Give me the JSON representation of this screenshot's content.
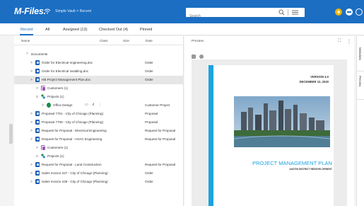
{
  "header": {
    "logo": "M-Files.",
    "vault_path": "Simple Vault > Recent",
    "search_placeholder": "Search"
  },
  "tabs": [
    {
      "label": "Recent",
      "active": true
    },
    {
      "label": "All"
    },
    {
      "label": "Assigned (13)"
    },
    {
      "label": "Checked Out (4)"
    },
    {
      "label": "Pinned"
    }
  ],
  "columns": {
    "name": "Name",
    "class": "Class",
    "size": "Size",
    "date": "Date"
  },
  "rows": [
    {
      "name": "Documents",
      "class": "",
      "arrow": "^",
      "icon": "none"
    },
    {
      "name": "Order for Electrical engineering.doc",
      "class": "Order",
      "arrow": ">",
      "icon": "doc"
    },
    {
      "name": "Order for Electrical installing.doc",
      "class": "Order",
      "arrow": ">",
      "icon": "doc"
    },
    {
      "name": "HB Project Management Plan.doc",
      "class": "Order",
      "arrow": ">",
      "icon": "doc",
      "selected": true
    },
    {
      "name": "Customers (1)",
      "class": "",
      "arrow": ">",
      "icon": "grid"
    },
    {
      "name": "Projects (1)",
      "class": "",
      "arrow": "v",
      "icon": "proj"
    },
    {
      "name": "Office Design",
      "class": "Customer Project",
      "arrow": ">",
      "icon": "office"
    },
    {
      "name": "Proposal 7701 - City of Chicago (Planning)",
      "class": "Proposal",
      "arrow": ">",
      "icon": "doc"
    },
    {
      "name": "Proposal 7708 - City of Chicago (Planning)",
      "class": "Proposal",
      "arrow": ">",
      "icon": "doc"
    },
    {
      "name": "Request for Proposal - Electrical Engineering",
      "class": "Request for Proposal",
      "arrow": ">",
      "icon": "doc"
    },
    {
      "name": "Request for Proposal - HVAC Engineering",
      "class": "Request for Proposal",
      "arrow": ">",
      "icon": "doc"
    },
    {
      "name": "Customers (1)",
      "class": "",
      "arrow": ">",
      "icon": "grid"
    },
    {
      "name": "Projects (1)",
      "class": "",
      "arrow": "v",
      "icon": "proj"
    },
    {
      "name": "Request for Proposal - Land Construction",
      "class": "Request for Proposal",
      "arrow": ">",
      "icon": "doc"
    },
    {
      "name": "Sales Invoice 237 - City of Chicago (Planning)",
      "class": "Order",
      "arrow": ">",
      "icon": "pdf"
    },
    {
      "name": "Sales Invoice 239 - City of Chicago (Planning)",
      "class": "Order",
      "arrow": ">",
      "icon": "pdf"
    }
  ],
  "preview": {
    "title": "Preview",
    "version": "VERSION 4.0",
    "date": "DECEMBER 12, 2020",
    "doc_title": "PROJECT MANAGEMENT PLAN",
    "doc_subtitle": "AUSTIN DISTRICT REDEVELOPMENT"
  },
  "side_tabs": [
    "Metadata",
    "Preview"
  ],
  "colors": {
    "brand": "#1b6ec2",
    "accent": "#1ba3e0",
    "selected_row": "#e6e6e6"
  }
}
